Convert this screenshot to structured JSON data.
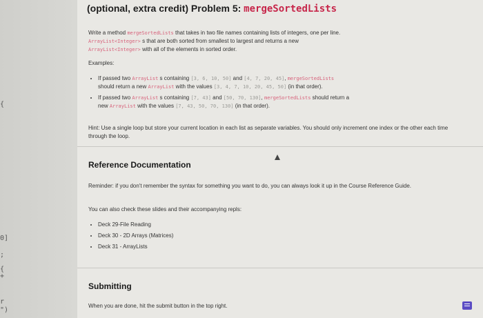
{
  "gutter": {
    "markers": [
      "{",
      "0]",
      ";",
      "{",
      "+",
      "r",
      "\")"
    ]
  },
  "problem": {
    "title_prefix": "(optional, extra credit) Problem 5: ",
    "title_code": "mergeSortedLists",
    "desc1_a": "Write a method ",
    "desc1_fn": "mergeSortedLists",
    "desc1_b": " that takes in two file names containing lists of integers, one per line.",
    "desc2_code": "ArrayList<Integer>",
    "desc2_b": " s that are both sorted from smallest to largest and returns a new",
    "desc3_code": "ArrayList<Integer>",
    "desc3_b": " with all of the elements in sorted order.",
    "examples_label": "Examples:",
    "ex1": {
      "a": "If passed two ",
      "code1": "ArrayList",
      "b": " s containing ",
      "list1": "[3, 6, 10, 50]",
      "c": " and ",
      "list2": "[4, 7, 20, 45]",
      "d": ", ",
      "fn": "mergeSortedLists",
      "e": "should return a new ",
      "code2": "ArrayList",
      "f": " with the values ",
      "result": "[3, 4, 7, 10, 20, 45, 50]",
      "g": " (in that order)."
    },
    "ex2": {
      "a": "If passed two ",
      "code1": "ArrayList",
      "b": " s containing ",
      "list1": "[7, 43]",
      "c": " and ",
      "list2": "[50, 70, 130]",
      "d": ", ",
      "fn": "mergeSortedLists",
      "e": " should return a",
      "f": "new ",
      "code2": "ArrayList",
      "g": " with the values ",
      "result": "[7, 43, 50, 70, 130]",
      "h": " (in that order)."
    },
    "hint": "Hint: Use a single loop but store your current location in each list as separate variables. You should only increment one index or the other each time through the loop."
  },
  "reference": {
    "heading": "Reference Documentation",
    "reminder": "Reminder: if you don't remember the syntax for something you want to do, you can always look it up in the Course Reference Guide.",
    "also": "You can also check these slides and their accompanying repls:",
    "decks": [
      "Deck 29-File Reading",
      "Deck 30 - 2D Arrays (Matrices)",
      "Deck 31 - ArrayLists"
    ]
  },
  "submitting": {
    "heading": "Submitting",
    "text": "When you are done, hit the submit button in the top right."
  }
}
